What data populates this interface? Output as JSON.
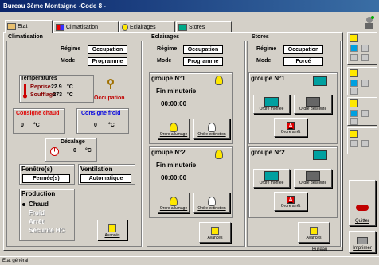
{
  "window": {
    "title": "Bureau 3ème Montaigne -Code 8 -"
  },
  "tabs": [
    {
      "label": "Etat",
      "icon": "stack-icon"
    },
    {
      "label": "Climatisation",
      "icon": "thermometer-snow-icon"
    },
    {
      "label": "Eclairages",
      "icon": "bulb-icon"
    },
    {
      "label": "Stores",
      "icon": "window-icon"
    }
  ],
  "clim": {
    "title": "Climatisation",
    "regime_label": "Régime",
    "regime_value": "Occupation",
    "mode_label": "Mode",
    "mode_value": "Programme",
    "temps_title": "Températures",
    "reprise_label": "Reprise",
    "reprise_value": "22.9",
    "reprise_unit": "°C",
    "soufflage_label": "Soufflage",
    "soufflage_value": "-273",
    "soufflage_unit": "°C",
    "occupation_label": "Occupation",
    "consigne_chaud_label": "Consigne chaud",
    "consigne_chaud_value": "0",
    "consigne_chaud_unit": "°C",
    "consigne_froid_label": "Consigne froid",
    "consigne_froid_value": "0",
    "consigne_froid_unit": "°C",
    "decalage_label": "Décalage",
    "decalage_value": "0",
    "decalage_unit": "°C",
    "fenetres_label": "Fenêtre(s)",
    "fenetres_value": "Fermée(s)",
    "ventilation_label": "Ventilation",
    "ventilation_value": "Automatique",
    "production_label": "Production",
    "production_options": [
      "Chaud",
      "Froid",
      "Arrêt",
      "Sécurité HG"
    ],
    "production_selected": "Chaud",
    "avances_label": "Avancés"
  },
  "eclairages": {
    "title": "Eclairages",
    "regime_label": "Régime",
    "regime_value": "Occupation",
    "mode_label": "Mode",
    "mode_value": "Programme",
    "groups": [
      {
        "title": "groupe N°1",
        "fin_label": "Fin minuterie",
        "timer": "00:00:00",
        "allumage_label": "Ordre allumage",
        "extinction_label": "Ordre extinction"
      },
      {
        "title": "groupe N°2",
        "fin_label": "Fin minuterie",
        "timer": "00:00:00",
        "allumage_label": "Ordre allumage",
        "extinction_label": "Ordre extinction"
      }
    ],
    "avances_label": "Avancés"
  },
  "stores": {
    "title": "Stores",
    "regime_label": "Régime",
    "regime_value": "Occupation",
    "mode_label": "Mode",
    "mode_value": "Forcé",
    "groups": [
      {
        "title": "groupe N°1",
        "montee_label": "Ordre montée",
        "descente_label": "Ordre descente",
        "arret_label": "Ordre arrêt"
      },
      {
        "title": "groupe N°2",
        "montee_label": "Ordre montée",
        "descente_label": "Ordre descente",
        "arret_label": "Ordre arrêt"
      }
    ],
    "avances_label": "Avancés"
  },
  "bureau_label": "Bureau",
  "sidebar": {
    "quitter_label": "Quitter",
    "imprimer_label": "Imprimer"
  },
  "status": "Etat général"
}
